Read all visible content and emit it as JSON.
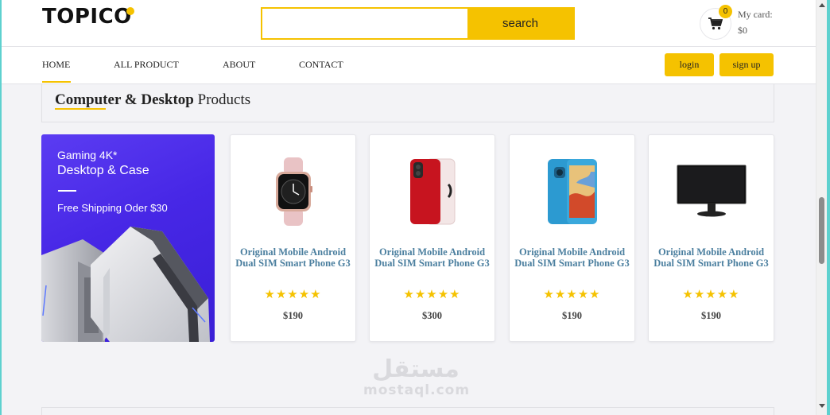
{
  "header": {
    "logo": "TOPICO",
    "search_placeholder": "",
    "search_label": "search",
    "cart_count": "0",
    "cart_label": "My card:",
    "cart_total": "$0"
  },
  "nav": {
    "items": [
      {
        "label": "HOME",
        "active": true
      },
      {
        "label": "ALL PRODUCT"
      },
      {
        "label": "ABOUT"
      },
      {
        "label": "CONTACT"
      }
    ],
    "login_label": "login",
    "signup_label": "sign up"
  },
  "section": {
    "title_bold": "Computer & Desktop",
    "title_rest": " Products"
  },
  "banner": {
    "subtitle": "Gaming 4K*",
    "title": "Desktop & Case",
    "shipping": "Free Shipping Oder $30"
  },
  "products": [
    {
      "image": "smartwatch-image",
      "name": "Original Mobile Android Dual SIM Smart Phone G3",
      "rating": 5,
      "stars": "★★★★★",
      "price": "$190"
    },
    {
      "image": "red-iphone-image",
      "name": "Original Mobile Android Dual SIM Smart Phone G3",
      "rating": 5,
      "stars": "★★★★★",
      "price": "$300"
    },
    {
      "image": "blue-galaxy-phone-image",
      "name": "Original Mobile Android Dual SIM Smart Phone G3",
      "rating": 5,
      "stars": "★★★★★",
      "price": "$190"
    },
    {
      "image": "monitor-image",
      "name": "Original Mobile Android Dual SIM Smart Phone G3",
      "rating": 5,
      "stars": "★★★★★",
      "price": "$190"
    }
  ],
  "watermark": {
    "arabic": "مستقل",
    "latin": "mostaql.com"
  },
  "colors": {
    "accent": "#f5c200",
    "product_name": "#4b7f9f",
    "banner_purple": "#4727e6",
    "page_bg": "#f3f3f6",
    "outer_bg": "#5ed1cf"
  },
  "icons": {
    "cart": "cart-icon"
  }
}
